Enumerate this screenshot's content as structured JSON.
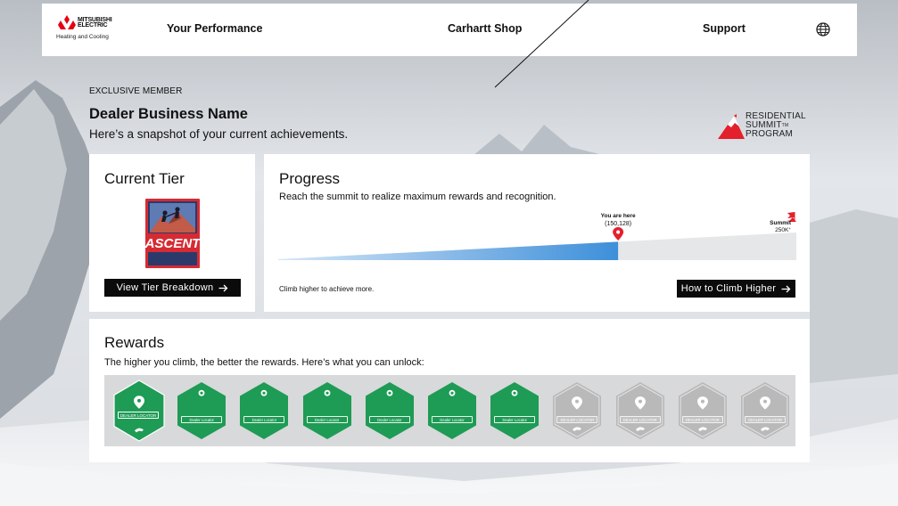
{
  "header": {
    "logo": {
      "brand_line1": "MITSUBISHI",
      "brand_line2": "ELECTRIC",
      "brand_line3": "Heating and Cooling",
      "mark_color": "#e60012"
    },
    "nav": {
      "performance": "Your Performance",
      "shop": "Carhartt Shop",
      "support": "Support"
    },
    "globe_icon": "globe-icon"
  },
  "hero": {
    "eyebrow": "EXCLUSIVE MEMBER",
    "title": "Dealer Business Name",
    "subtitle": "Here’s a snapshot of your current achievements."
  },
  "program_logo": {
    "line1": "RESIDENTIAL",
    "line2": "SUMMIT",
    "tm": "TM",
    "line3": "PROGRAM",
    "color": "#e4202c"
  },
  "current_tier": {
    "title": "Current Tier",
    "badge_text": "ASCENT",
    "button_label": "View Tier Breakdown",
    "button_icon": "arrow-right-icon"
  },
  "progress": {
    "title": "Progress",
    "subtitle": "Reach the summit to realize maximum rewards and recognition.",
    "marker_label": "You are here",
    "marker_value_text": "(150,128)",
    "current_value": 150128,
    "summit_label": "Summit",
    "summit_value_text": "250K",
    "summit_value_suffix": "+",
    "fill_fraction": 0.656,
    "footer_text": "Climb higher to achieve more.",
    "button_label": "How to Climb Higher",
    "button_icon": "arrow-right-icon",
    "colors": {
      "fill": "#3d8fda",
      "track": "#e6e7e8",
      "marker": "#e4202c"
    }
  },
  "rewards": {
    "title": "Rewards",
    "subtitle": "The higher you climb, the better the rewards. Here’s what you can unlock:",
    "badges": [
      {
        "label": "DEALER LOCATOR",
        "state": "earned-highlight"
      },
      {
        "label": "Dealer Locator",
        "state": "earned"
      },
      {
        "label": "Dealer Locator",
        "state": "earned"
      },
      {
        "label": "Dealer Locator",
        "state": "earned"
      },
      {
        "label": "Dealer Locator",
        "state": "earned"
      },
      {
        "label": "Dealer Locator",
        "state": "earned"
      },
      {
        "label": "Dealer Locator",
        "state": "earned"
      },
      {
        "label": "DEALER LOCATOR",
        "state": "locked"
      },
      {
        "label": "DEALER LOCATOR",
        "state": "locked"
      },
      {
        "label": "DEALER LOCATOR",
        "state": "locked"
      },
      {
        "label": "DEALER LOCATOR",
        "state": "locked"
      }
    ],
    "colors": {
      "earned": "#1e9b55",
      "locked": "#b9b9b9"
    }
  }
}
